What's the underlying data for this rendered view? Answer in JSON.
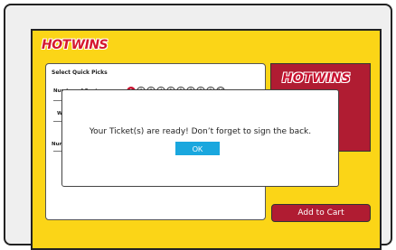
{
  "app": {
    "logo_hot": "HOT",
    "logo_wins": "WINS"
  },
  "quick_picks": {
    "title": "Select Quick Picks",
    "number_of_spots_label": "Number of Spots",
    "wager_label": "Wag",
    "number_label": "Numb",
    "spots": [
      "1",
      "2",
      "3",
      "4",
      "5",
      "6",
      "7",
      "8",
      "9",
      "10"
    ],
    "selected_spot": "1"
  },
  "side_panel": {
    "logo_hot": "HOT",
    "logo_wins": "WINS"
  },
  "cart": {
    "add_to_cart_label": "Add to Cart"
  },
  "modal": {
    "message": "Your Ticket(s) are ready! Don’t forget to sign the back.",
    "ok_label": "OK"
  },
  "colors": {
    "screen_bg": "#fbd517",
    "brand_red": "#b01c32",
    "ok_blue": "#1aa7de"
  }
}
